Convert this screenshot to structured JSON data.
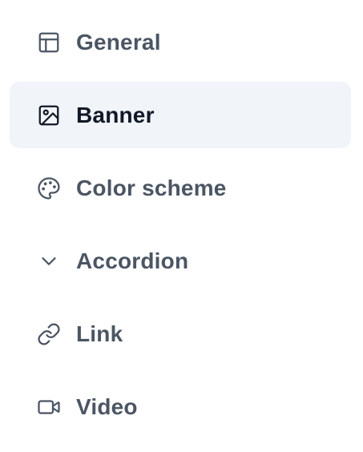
{
  "nav": {
    "items": [
      {
        "label": "General",
        "icon": "layout-icon",
        "active": false
      },
      {
        "label": "Banner",
        "icon": "image-icon",
        "active": true
      },
      {
        "label": "Color scheme",
        "icon": "palette-icon",
        "active": false
      },
      {
        "label": "Accordion",
        "icon": "chevron-down-icon",
        "active": false
      },
      {
        "label": "Link",
        "icon": "link-icon",
        "active": false
      },
      {
        "label": "Video",
        "icon": "video-icon",
        "active": false
      }
    ]
  },
  "colors": {
    "text": "#4b5563",
    "active_text": "#111827",
    "active_background": "#f1f4f9"
  }
}
